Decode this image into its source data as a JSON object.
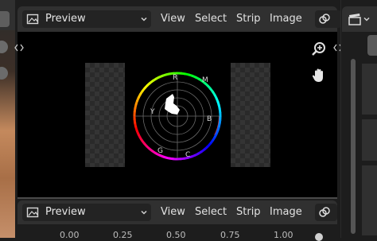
{
  "top_header": {
    "editor_type_icon": "image-editor-icon",
    "view_mode": "Preview",
    "menus": [
      "View",
      "Select",
      "Strip",
      "Image"
    ],
    "overlay_icon": "overlay-link-icon"
  },
  "viewport": {
    "zoom_icon": "zoom-in-icon",
    "pan_icon": "hand-pan-icon",
    "scope_labels": {
      "r": "R",
      "m": "M",
      "y": "Y",
      "b": "B",
      "g": "G",
      "c": "C"
    }
  },
  "bottom_header": {
    "editor_type_icon": "image-editor-icon",
    "view_mode": "Preview",
    "menus": [
      "View",
      "Select",
      "Strip",
      "Image"
    ],
    "overlay_icon": "overlay-link-icon"
  },
  "timeline_ruler": {
    "ticks": [
      "0.00",
      "0.25",
      "0.50",
      "0.75",
      "1.00"
    ]
  },
  "right_panel": {
    "icon": "clapperboard-icon"
  },
  "colors": {
    "header_bg": "#303030",
    "viewport_bg": "#000000",
    "accent": "#4772b3"
  }
}
